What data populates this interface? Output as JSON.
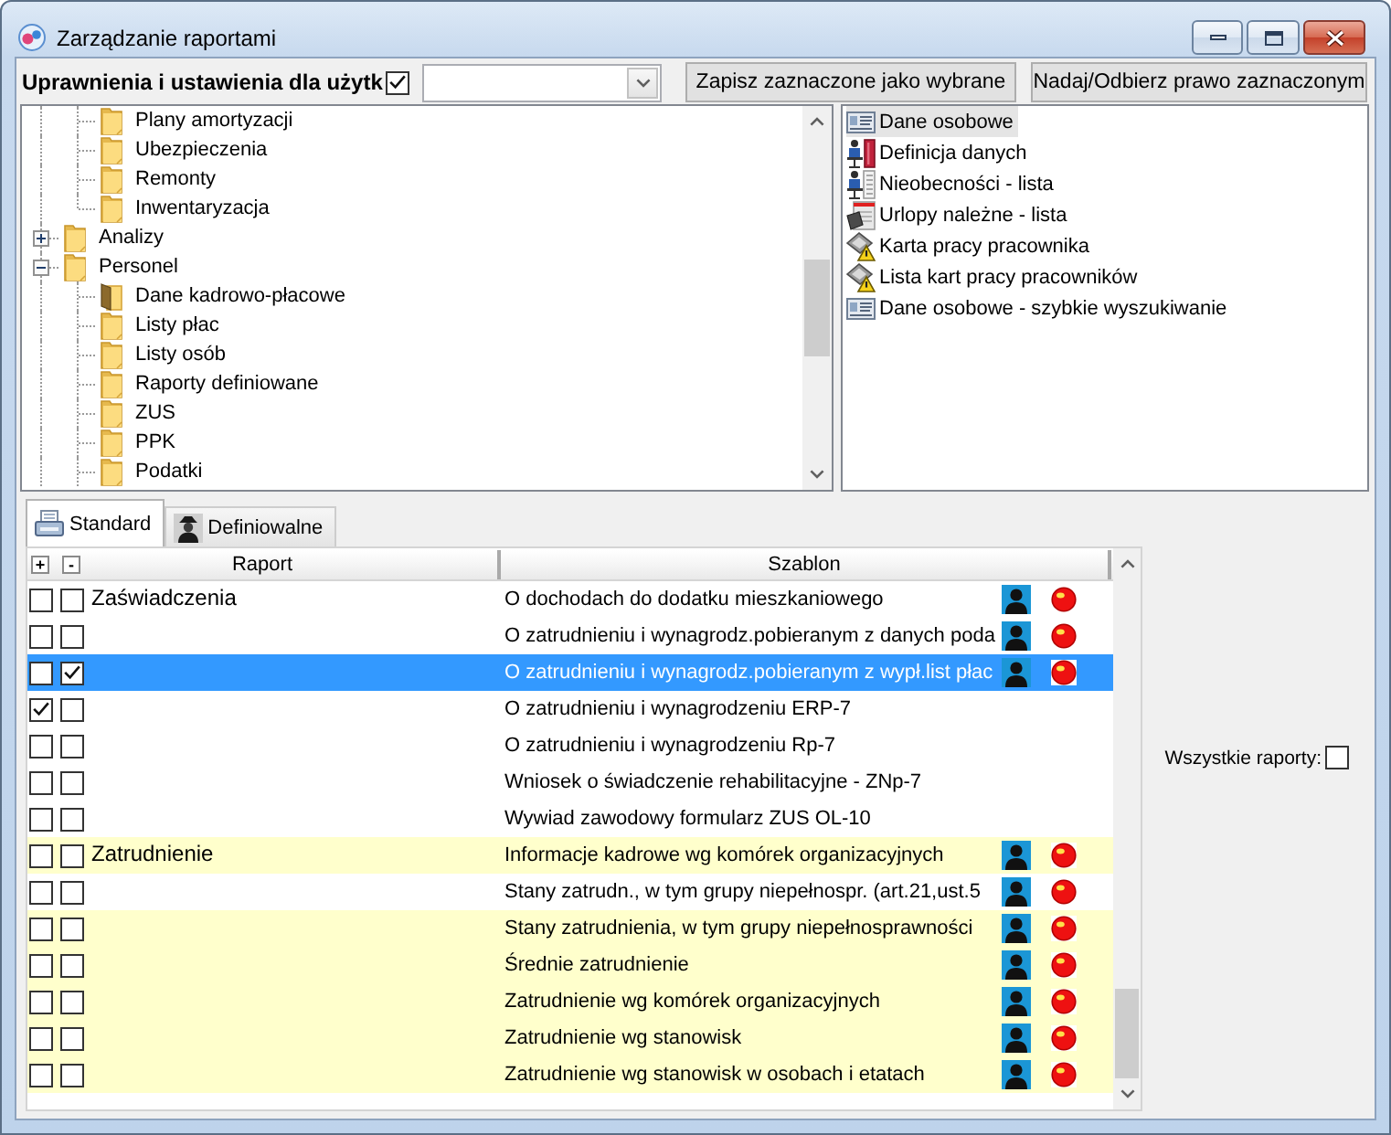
{
  "window": {
    "title": "Zarządzanie raportami"
  },
  "toolbar": {
    "label": "Uprawnienia i ustawienia dla użytk",
    "checked": true,
    "buttons": [
      "Zapisz zaznaczone jako wybrane",
      "Nadaj/Odbierz prawo zaznaczonym"
    ]
  },
  "tree": {
    "items": [
      {
        "kind": "continued",
        "children": [
          {
            "label": "Plany amortyzacji",
            "selected": false
          },
          {
            "label": "Ubezpieczenia",
            "selected": false
          },
          {
            "label": "Remonty",
            "selected": false
          },
          {
            "label": "Inwentaryzacja",
            "selected": false
          }
        ]
      },
      {
        "kind": "folder",
        "label": "Analizy",
        "expanded": false,
        "selected": false
      },
      {
        "kind": "folder",
        "label": "Personel",
        "expanded": true,
        "selected": false,
        "children": [
          {
            "label": "Dane kadrowo-płacowe",
            "selected": true
          },
          {
            "label": "Listy płac",
            "selected": false
          },
          {
            "label": "Listy osób",
            "selected": false
          },
          {
            "label": "Raporty definiowane",
            "selected": false
          },
          {
            "label": "ZUS",
            "selected": false
          },
          {
            "label": "PPK",
            "selected": false
          },
          {
            "label": "Podatki",
            "selected": false
          }
        ]
      }
    ]
  },
  "report_list": {
    "items": [
      {
        "kind": "idcard",
        "label": "Dane osobowe",
        "selected": true
      },
      {
        "kind": "binder",
        "label": "Definicja danych",
        "selected": false
      },
      {
        "kind": "roster",
        "label": "Nieobecności - lista",
        "selected": false
      },
      {
        "kind": "device",
        "label": "Urlopy należne - lista",
        "selected": false
      },
      {
        "kind": "warning",
        "label": "Karta pracy pracownika",
        "selected": false
      },
      {
        "kind": "warning",
        "label": "Lista kart pracy pracowników",
        "selected": false
      },
      {
        "kind": "idcard",
        "label": "Dane osobowe - szybkie wyszukiwanie",
        "selected": false
      }
    ]
  },
  "tabs": [
    {
      "kind": "printer",
      "label": "Standard",
      "selected": true
    },
    {
      "kind": "figure",
      "label": "Definiowalne",
      "selected": false
    }
  ],
  "table": {
    "header_buttons": [
      "+",
      "-"
    ],
    "columns": [
      "Raport",
      "Szablon"
    ],
    "rows": [
      {
        "group": "Zaświadczenia",
        "checks": [
          {
            "checked": false
          },
          {
            "checked": false
          }
        ],
        "template": "O dochodach do dodatku mieszkaniowego",
        "icons": true,
        "highlighted": false,
        "selected": false
      },
      {
        "checks": [
          {
            "checked": false
          },
          {
            "checked": false
          }
        ],
        "template": "O zatrudnieniu i wynagrodz.pobieranym z danych poda",
        "icons": true,
        "highlighted": false,
        "selected": false
      },
      {
        "checks": [
          {
            "checked": false
          },
          {
            "checked": true
          }
        ],
        "template": "O zatrudnieniu i wynagrodz.pobieranym z wypł.list płac",
        "icons": true,
        "highlighted": false,
        "selected": true
      },
      {
        "checks": [
          {
            "checked": true
          },
          {
            "checked": false
          }
        ],
        "template": "O zatrudnieniu i wynagrodzeniu ERP-7",
        "icons": false,
        "highlighted": false,
        "selected": false
      },
      {
        "checks": [
          {
            "checked": false
          },
          {
            "checked": false
          }
        ],
        "template": "O zatrudnieniu i wynagrodzeniu Rp-7",
        "icons": false,
        "highlighted": false,
        "selected": false
      },
      {
        "checks": [
          {
            "checked": false
          },
          {
            "checked": false
          }
        ],
        "template": "Wniosek o świadczenie rehabilitacyjne - ZNp-7",
        "icons": false,
        "highlighted": false,
        "selected": false
      },
      {
        "checks": [
          {
            "checked": false
          },
          {
            "checked": false
          }
        ],
        "template": "Wywiad zawodowy formularz ZUS OL-10",
        "icons": false,
        "highlighted": false,
        "selected": false
      },
      {
        "group": "Zatrudnienie",
        "checks": [
          {
            "checked": false
          },
          {
            "checked": false
          }
        ],
        "template": "Informacje kadrowe wg komórek organizacyjnych",
        "icons": true,
        "highlighted": true,
        "selected": false
      },
      {
        "checks": [
          {
            "checked": false
          },
          {
            "checked": false
          }
        ],
        "template": "Stany zatrudn., w tym grupy niepełnospr. (art.21,ust.5",
        "icons": true,
        "highlighted": false,
        "selected": false
      },
      {
        "checks": [
          {
            "checked": false
          },
          {
            "checked": false
          }
        ],
        "template": "Stany zatrudnienia, w tym grupy niepełnosprawności",
        "icons": true,
        "highlighted": true,
        "selected": false
      },
      {
        "checks": [
          {
            "checked": false
          },
          {
            "checked": false
          }
        ],
        "template": "Średnie zatrudnienie",
        "icons": true,
        "highlighted": true,
        "selected": false
      },
      {
        "checks": [
          {
            "checked": false
          },
          {
            "checked": false
          }
        ],
        "template": "Zatrudnienie wg komórek organizacyjnych",
        "icons": true,
        "highlighted": true,
        "selected": false
      },
      {
        "checks": [
          {
            "checked": false
          },
          {
            "checked": false
          }
        ],
        "template": "Zatrudnienie wg stanowisk",
        "icons": true,
        "highlighted": true,
        "selected": false
      },
      {
        "checks": [
          {
            "checked": false
          },
          {
            "checked": false
          }
        ],
        "template": "Zatrudnienie wg stanowisk w osobach i etatach",
        "icons": true,
        "highlighted": true,
        "selected": false
      }
    ]
  },
  "all_reports": {
    "label": "Wszystkie raporty:",
    "checked": false
  }
}
